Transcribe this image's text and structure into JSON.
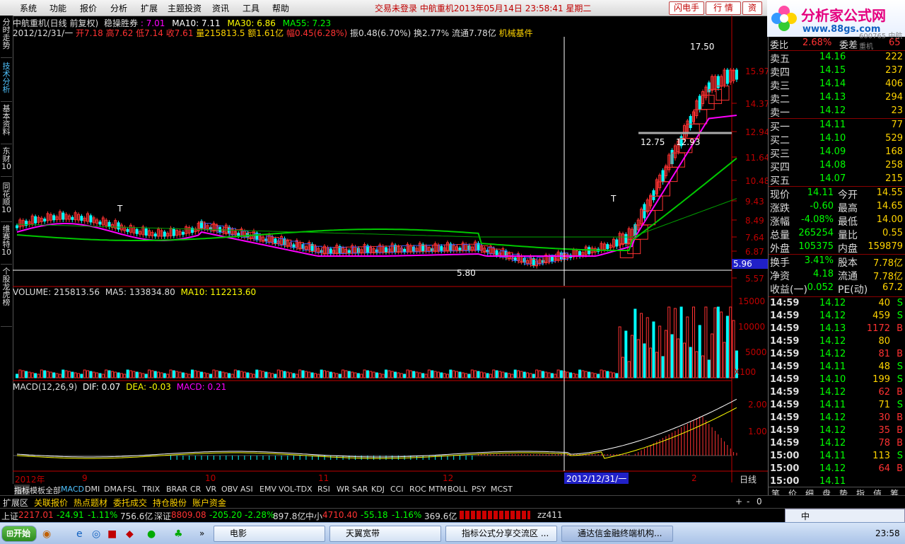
{
  "menu": [
    "系统",
    "功能",
    "报价",
    "分析",
    "扩展",
    "主题投资",
    "资讯",
    "工具",
    "帮助"
  ],
  "status": "交易未登录   中航重机2013年05月14日  23:58:41  星期二",
  "top_buttons": [
    "闪电手",
    "行 情",
    "资"
  ],
  "logo": {
    "title": "分析家公式网",
    "url": "www.88gs.com",
    "code": "600765 中航重机"
  },
  "left_tabs": [
    "分时走势",
    "技术分析",
    "基本资料",
    "东财10",
    "同花顺10",
    "维赛特10",
    "个股龙虎榜"
  ],
  "header": {
    "line1": {
      "name": "中航重机(日线 前复权)",
      "indicator": "稳操胜券",
      "v1": ": 7.01",
      "ma10": "MA10: 7.11",
      "ma30": "MA30: 6.86",
      "ma55": "MA55: 7.23"
    },
    "line2": {
      "date": "2012/12/31/一",
      "open": "开7.18",
      "high": "高7.62",
      "low": "低7.14",
      "close": "收7.61",
      "vol": "量215813.5",
      "amt": "额1.61亿",
      "chg": "幅0.45(6.28%)",
      "amp": "振0.48(6.70%)",
      "turn": "换2.77%",
      "float": "流通7.78亿",
      "sector": "机械基件"
    }
  },
  "price_axis": [
    "15.97",
    "14.37",
    "12.94",
    "11.64",
    "10.48",
    "9.43",
    "8.49",
    "7.64",
    "6.87",
    "6.19",
    "5.57"
  ],
  "price_tag": "5.96",
  "annotations": {
    "high": "17.50",
    "support_left": "12.75",
    "support_right": "12.93",
    "low": "5.80",
    "t1": "T",
    "t2": "T"
  },
  "volume": {
    "label": "VOLUME: 215813.56",
    "ma5": "MA5: 133834.80",
    "ma10": "MA10: 112213.60",
    "axis": [
      "15000",
      "10000",
      "5000"
    ],
    "unit": "X100"
  },
  "macd": {
    "label": "MACD(12,26,9)",
    "dif": "DIF: 0.07",
    "dea": "DEA: -0.03",
    "macd": "MACD: 0.21",
    "axis": [
      "2.00",
      "1.00"
    ]
  },
  "time_axis": {
    "labels": [
      "2012年",
      "9",
      "10",
      "11",
      "12",
      "2"
    ],
    "cursor": "2012/12/31/一",
    "period": "日线"
  },
  "right_panel": {
    "top": {
      "l1": "委比",
      "v1": "2.68%",
      "l2": "委差",
      "v2": "65"
    },
    "sells": [
      {
        "label": "卖五",
        "price": "14.16",
        "vol": "222"
      },
      {
        "label": "卖四",
        "price": "14.15",
        "vol": "237"
      },
      {
        "label": "卖三",
        "price": "14.14",
        "vol": "406"
      },
      {
        "label": "卖二",
        "price": "14.13",
        "vol": "294"
      },
      {
        "label": "卖一",
        "price": "14.12",
        "vol": "23"
      }
    ],
    "buys": [
      {
        "label": "买一",
        "price": "14.11",
        "vol": "77"
      },
      {
        "label": "买二",
        "price": "14.10",
        "vol": "529"
      },
      {
        "label": "买三",
        "price": "14.09",
        "vol": "168"
      },
      {
        "label": "买四",
        "price": "14.08",
        "vol": "258"
      },
      {
        "label": "买五",
        "price": "14.07",
        "vol": "215"
      }
    ],
    "quote": [
      {
        "l1": "现价",
        "v1": "14.11",
        "l2": "今开",
        "v2": "14.55"
      },
      {
        "l1": "涨跌",
        "v1": "-0.60",
        "l2": "最高",
        "v2": "14.65"
      },
      {
        "l1": "涨幅",
        "v1": "-4.08%",
        "l2": "最低",
        "v2": "14.00"
      },
      {
        "l1": "总量",
        "v1": "265254",
        "l2": "量比",
        "v2": "0.55"
      },
      {
        "l1": "外盘",
        "v1": "105375",
        "l2": "内盘",
        "v2": "159879"
      }
    ],
    "fund": [
      {
        "l1": "换手",
        "v1": "3.41%",
        "l2": "股本",
        "v2": "7.78亿"
      },
      {
        "l1": "净资",
        "v1": "4.18",
        "l2": "流通",
        "v2": "7.78亿"
      },
      {
        "l1": "收益(一)",
        "v1": "0.052",
        "l2": "PE(动)",
        "v2": "67.2"
      }
    ],
    "ticks": [
      {
        "t": "14:59",
        "p": "14.12",
        "v": "40",
        "s": "S"
      },
      {
        "t": "14:59",
        "p": "14.12",
        "v": "459",
        "s": "S"
      },
      {
        "t": "14:59",
        "p": "14.13",
        "v": "1172",
        "s": "B"
      },
      {
        "t": "14:59",
        "p": "14.12",
        "v": "80",
        "s": ""
      },
      {
        "t": "14:59",
        "p": "14.12",
        "v": "81",
        "s": "B"
      },
      {
        "t": "14:59",
        "p": "14.11",
        "v": "48",
        "s": "S"
      },
      {
        "t": "14:59",
        "p": "14.10",
        "v": "199",
        "s": "S"
      },
      {
        "t": "14:59",
        "p": "14.12",
        "v": "62",
        "s": "B"
      },
      {
        "t": "14:59",
        "p": "14.11",
        "v": "71",
        "s": "S"
      },
      {
        "t": "14:59",
        "p": "14.12",
        "v": "30",
        "s": "B"
      },
      {
        "t": "14:59",
        "p": "14.12",
        "v": "35",
        "s": "B"
      },
      {
        "t": "14:59",
        "p": "14.12",
        "v": "78",
        "s": "B"
      },
      {
        "t": "15:00",
        "p": "14.11",
        "v": "113",
        "s": "S"
      },
      {
        "t": "15:00",
        "p": "14.12",
        "v": "64",
        "s": "B"
      },
      {
        "t": "15:00",
        "p": "14.11",
        "v": "",
        "s": ""
      }
    ],
    "bottom_tabs": [
      "笔",
      "价",
      "细",
      "盘",
      "势",
      "指",
      "值",
      "筹"
    ]
  },
  "indicator_tabs": [
    "指标",
    "模板",
    "全部",
    "MACD",
    "DMI",
    "DMA",
    "FSL",
    "TRIX",
    "BRAR",
    "CR",
    "VR",
    "OBV",
    "ASI",
    "EMV",
    "VOL-TDX",
    "RSI",
    "WR",
    "SAR",
    "KDJ",
    "CCI",
    "ROC",
    "MTM",
    "BOLL",
    "PSY",
    "MCST"
  ],
  "ext_tabs": [
    "扩展区",
    "关联报价",
    "热点题材",
    "委托成交",
    "持仓股份",
    "账户资金"
  ],
  "index_bar": {
    "sh": {
      "name": "上证",
      "val": "2217.01",
      "chg": "-24.91",
      "pct": "-1.11%",
      "amt": "756.6亿"
    },
    "sz": {
      "name": "深证",
      "val": "8809.08",
      "chg": "-205.20",
      "pct": "-2.28%",
      "amt": "897.8亿"
    },
    "zx": {
      "name": "中小",
      "val": "4710.40",
      "chg": "-55.18",
      "pct": "-1.16%",
      "amt": "369.6亿"
    },
    "extra": "zz411"
  },
  "taskbar": {
    "start": "开始",
    "tasks": [
      "电影",
      "天翼宽带",
      "指标公式分享交流区 ...",
      "通达信金融终端机构..."
    ],
    "ime": "中",
    "clock": "23:58"
  },
  "colors": {
    "up": "#ff3232",
    "down": "#00ffff",
    "yellow": "#ffd400",
    "ma_white": "#ffffff",
    "ma_yellow": "#ffff00",
    "ma_green": "#00c800",
    "ma_magenta": "#ff00ff"
  }
}
